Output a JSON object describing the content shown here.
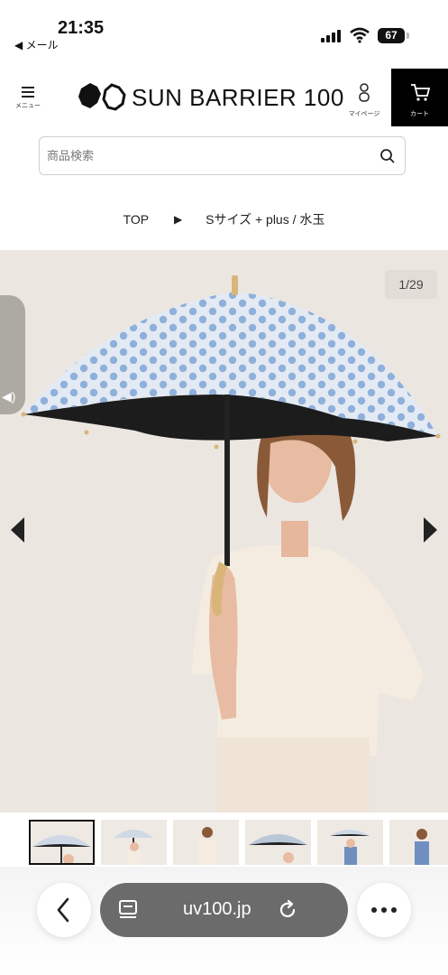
{
  "status_bar": {
    "time": "21:35",
    "back_label": "◀ メール",
    "battery": "67"
  },
  "header": {
    "menu_label": "メニュー",
    "logo_text": "SUN BARRIER 100",
    "mypage_label": "マイページ",
    "cart_label": "カート"
  },
  "search": {
    "placeholder": "商品検索"
  },
  "breadcrumb": {
    "home": "TOP",
    "separator": "▶",
    "current": "Sサイズ + plus / 水玉"
  },
  "gallery": {
    "counter": "1/29",
    "thumbnail_count": 6,
    "selected_thumbnail": 1
  },
  "browser": {
    "url": "uv100.jp"
  },
  "colors": {
    "canopy": "#dfe7f1",
    "dots": "#8fb0da",
    "background": "#ece6e1",
    "cart_bg": "#000000",
    "pill": "#6b6b6b"
  }
}
